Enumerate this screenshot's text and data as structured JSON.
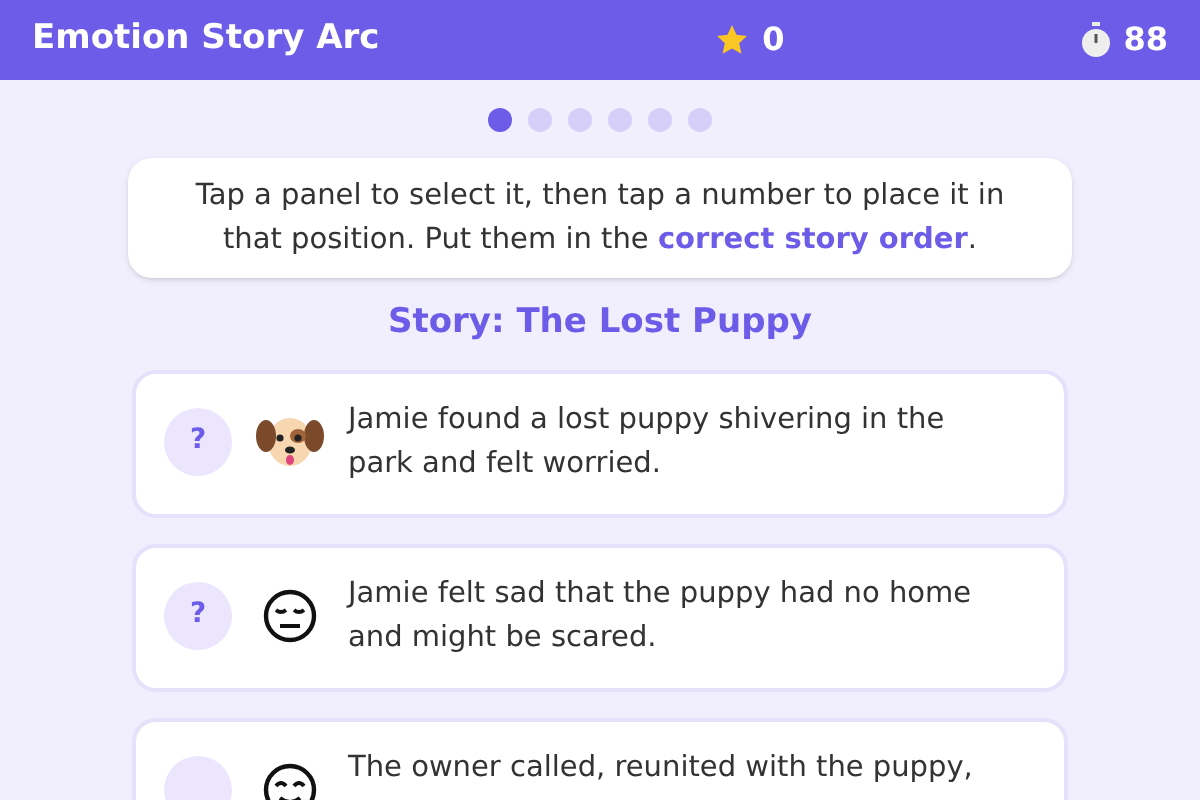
{
  "header": {
    "title": "Emotion Story Arc",
    "score": "0",
    "timer": "88"
  },
  "steps": [
    {
      "selected": true
    },
    {
      "selected": false
    },
    {
      "selected": false
    },
    {
      "selected": false
    },
    {
      "selected": false
    },
    {
      "selected": false
    }
  ],
  "instructions": "Tap a panel to select it, then tap a number to place it in that position. Put them in the **correct story order**.",
  "story_title": "Story: The Lost Puppy",
  "panels": [
    {
      "slot": "?",
      "kind": "dog",
      "text": "Jamie found a lost puppy shivering in the park and felt worried."
    },
    {
      "slot": "?",
      "kind": "sad",
      "text": "Jamie felt sad that the puppy had no home and might be scared."
    },
    {
      "kind": "happy",
      "text": "The owner called, reunited with the puppy,"
    }
  ]
}
